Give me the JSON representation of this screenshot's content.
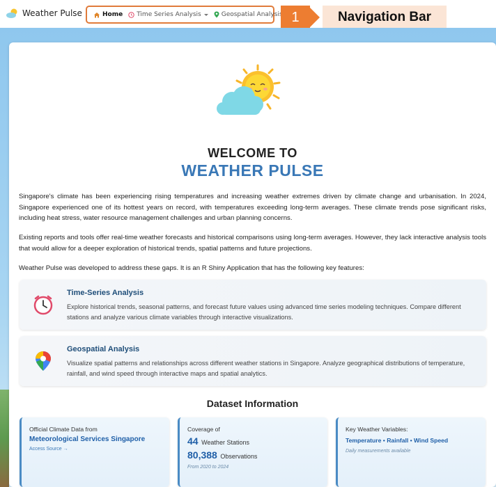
{
  "navbar": {
    "brand": "Weather Pulse",
    "items": [
      {
        "label": "Home",
        "icon": "home-icon"
      },
      {
        "label": "Time Series Analysis",
        "icon": "clock-icon"
      },
      {
        "label": "Geospatial Analysis",
        "icon": "map-pin-icon"
      }
    ]
  },
  "callout": {
    "number": "1",
    "label": "Navigation Bar",
    "color": "#ed7d31"
  },
  "hero": {
    "welcome": "WELCOME TO",
    "app_name": "WEATHER PULSE"
  },
  "intro": {
    "p1": "Singapore's climate has been experiencing rising temperatures and increasing weather extremes driven by climate change and urbanisation. In 2024, Singapore experienced one of its hottest years on record, with temperatures exceeding long-term averages. These climate trends pose significant risks, including heat stress, water resource management challenges and urban planning concerns.",
    "p2": "Existing reports and tools offer real-time weather forecasts and historical comparisons using long-term averages. However, they lack interactive analysis tools that would allow for a deeper exploration of historical trends, spatial patterns and future projections.",
    "p3": "Weather Pulse was developed to address these gaps. It is an R Shiny Application that has the following key features:"
  },
  "features": [
    {
      "title": "Time-Series Analysis",
      "description": "Explore historical trends, seasonal patterns, and forecast future values using advanced time series modeling techniques. Compare different stations and analyze various climate variables through interactive visualizations."
    },
    {
      "title": "Geospatial Analysis",
      "description": "Visualize spatial patterns and relationships across different weather stations in Singapore. Analyze geographical distributions of temperature, rainfall, and wind speed through interactive maps and spatial analytics."
    }
  ],
  "dataset": {
    "title": "Dataset Information",
    "source": {
      "label": "Official Climate Data from",
      "org": "Meteorological Services Singapore",
      "link": "Access Source →"
    },
    "coverage": {
      "label": "Coverage of",
      "stations": "44",
      "stations_label": "Weather Stations",
      "observations": "80,388",
      "observations_label": "Observations",
      "period": "From 2020 to 2024"
    },
    "variables": {
      "label": "Key Weather Variables:",
      "list": "Temperature • Rainfall • Wind Speed",
      "note": "Daily measurements available"
    }
  }
}
